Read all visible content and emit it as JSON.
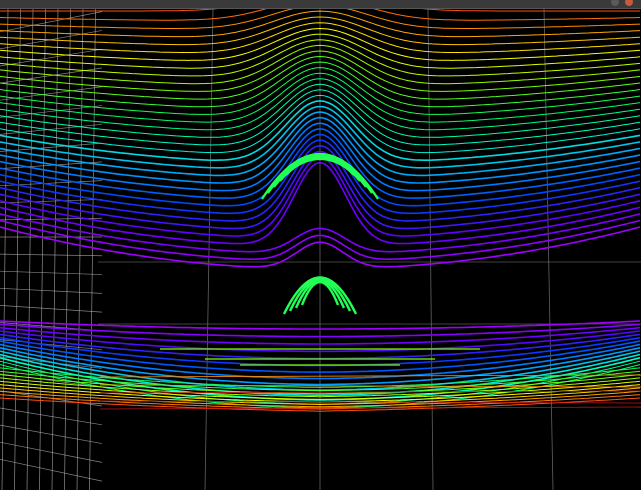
{
  "window": {
    "title": "",
    "close_label": "",
    "minimize_label": ""
  },
  "plot": {
    "colormap": [
      "#ff2020",
      "#ff8c00",
      "#ffff00",
      "#7dff00",
      "#00ff60",
      "#00ffd0",
      "#00a0ff",
      "#0040ff",
      "#6000ff",
      "#a000ff"
    ],
    "grid_color": "#8c8c8c",
    "side_grid_color": "#bdbdbd",
    "background": "#000000"
  },
  "status": {
    "text": ""
  }
}
